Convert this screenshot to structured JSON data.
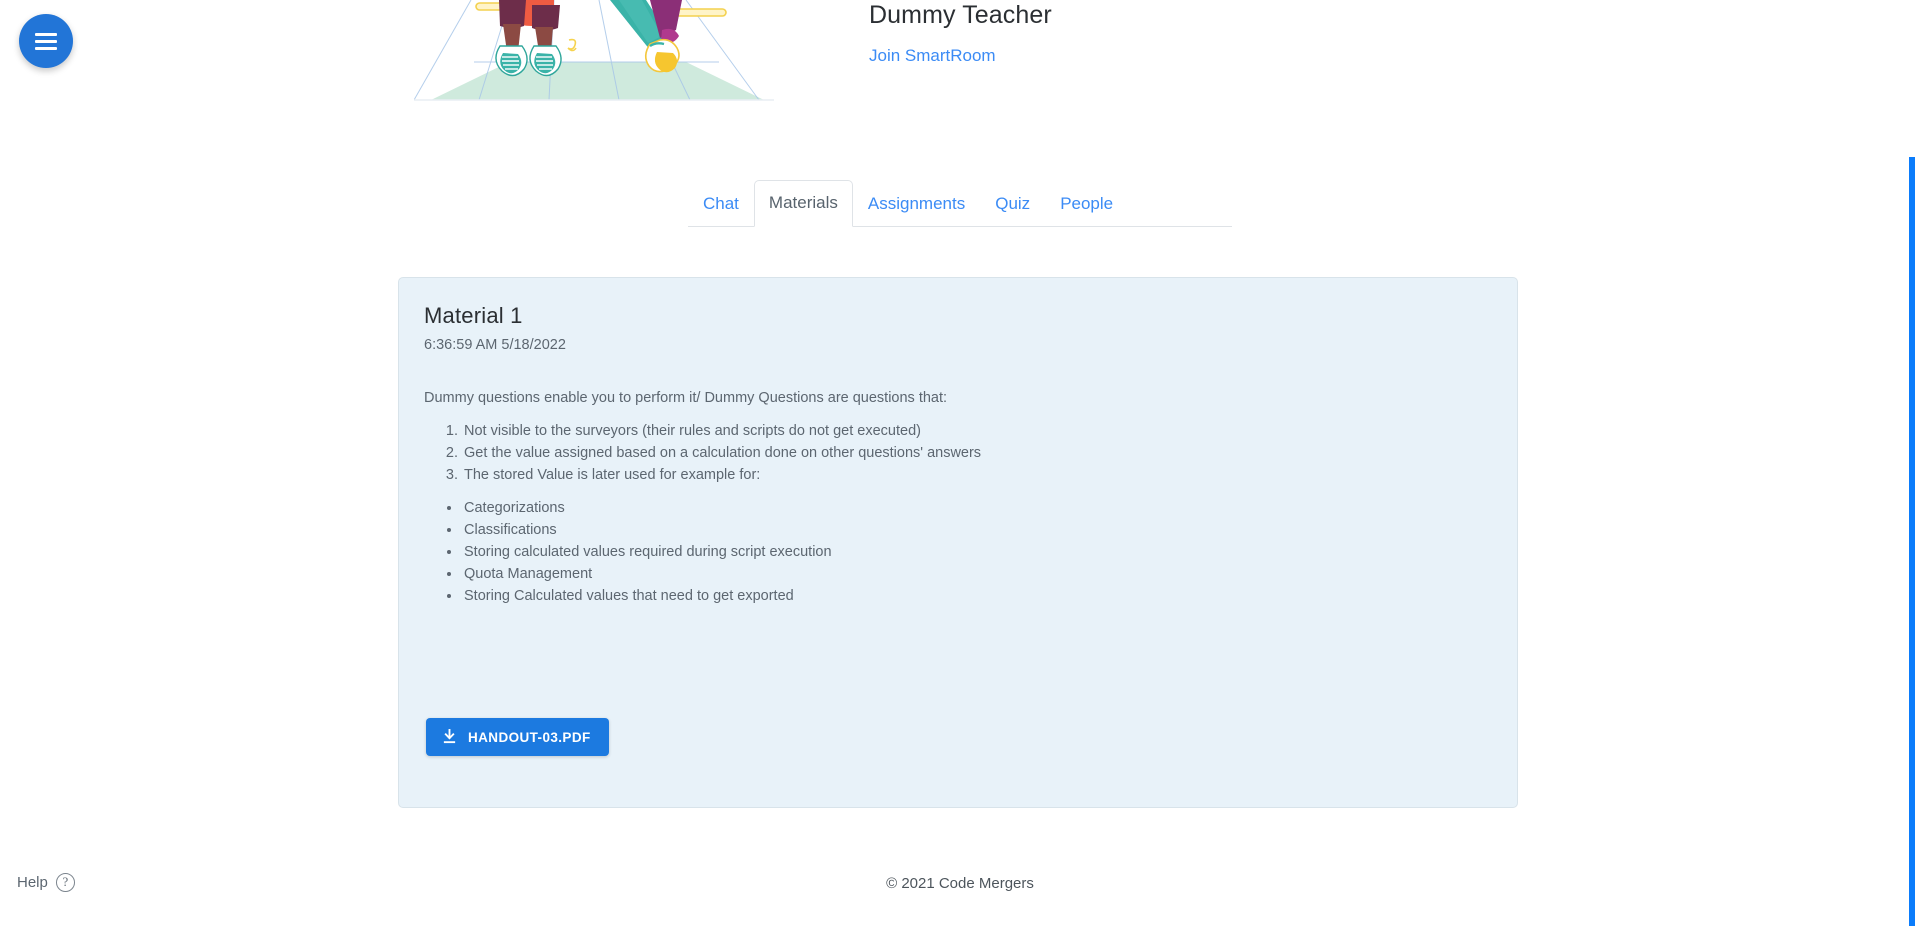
{
  "menu": {
    "icon": "hamburger-icon",
    "label": "Menu"
  },
  "hero": {
    "illustration_alt": "children-on-swings-illustration",
    "teacher_name": "Dummy Teacher",
    "join_link": "Join SmartRoom"
  },
  "tabs": [
    {
      "label": "Chat",
      "active": false
    },
    {
      "label": "Materials",
      "active": true
    },
    {
      "label": "Assignments",
      "active": false
    },
    {
      "label": "Quiz",
      "active": false
    },
    {
      "label": "People",
      "active": false
    }
  ],
  "material": {
    "title": "Material 1",
    "date": "6:36:59 AM 5/18/2022",
    "intro": "Dummy questions enable you to perform it/ Dummy Questions are questions that:",
    "numbered": [
      "Not visible to the surveyors (their rules and scripts do not get executed)",
      "Get the value assigned based on a calculation done on other questions' answers",
      "The stored Value is later used for example for:"
    ],
    "bullets": [
      "Categorizations",
      "Classifications",
      "Storing calculated values required during script execution",
      "Quota Management",
      "Storing Calculated values that need to get exported"
    ],
    "attachment": {
      "label": "HANDOUT-03.PDF",
      "icon": "download-icon"
    }
  },
  "footer": {
    "help_label": "Help",
    "help_icon_char": "?",
    "copyright": "© 2021 Code Mergers"
  },
  "colors": {
    "accent_blue": "#2275d7",
    "link_blue": "#3b8bf5",
    "button_blue": "#1c7ae0",
    "card_bg": "#e8f2f9",
    "scrollbar": "#0b7cfb"
  }
}
